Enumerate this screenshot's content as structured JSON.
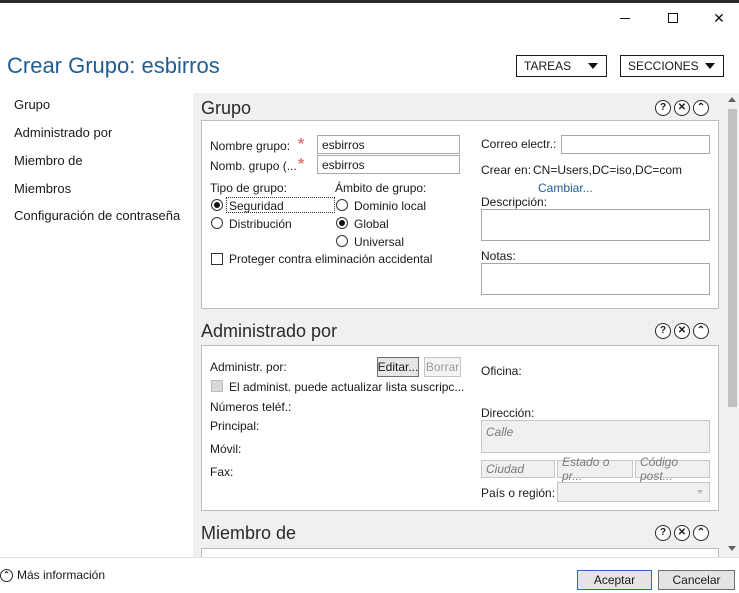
{
  "window": {
    "minimize_glyph": "—",
    "maximize_glyph": "☐",
    "close_glyph": "✕"
  },
  "header": {
    "title": "Crear Grupo: esbirros",
    "tasks_label": "TAREAS",
    "sections_label": "SECCIONES"
  },
  "nav": {
    "items": [
      {
        "label": "Grupo"
      },
      {
        "label": "Administrado por"
      },
      {
        "label": "Miembro de"
      },
      {
        "label": "Miembros"
      },
      {
        "label": "Configuración de contraseña"
      }
    ]
  },
  "section_controls": {
    "help": "?",
    "close": "✕",
    "collapse": "⌃"
  },
  "grupo": {
    "title": "Grupo",
    "group_name_label": "Nombre grupo:",
    "group_name_value": "esbirros",
    "group_name_pre2000_label": "Nomb. grupo (...",
    "group_name_pre2000_value": "esbirros",
    "group_type_label": "Tipo de grupo:",
    "type_security": "Seguridad",
    "type_distribution": "Distribución",
    "group_scope_label": "Ámbito de grupo:",
    "scope_domain_local": "Dominio local",
    "scope_global": "Global",
    "scope_universal": "Universal",
    "protect_label": "Proteger contra eliminación accidental",
    "email_label": "Correo electr.:",
    "email_value": "",
    "create_in_label": "Crear en:",
    "create_in_value": "CN=Users,DC=iso,DC=com",
    "change_link": "Cambiar...",
    "description_label": "Descripción:",
    "description_value": "",
    "notes_label": "Notas:",
    "notes_value": ""
  },
  "managed_by": {
    "title": "Administrado por",
    "managed_by_label": "Administr. por:",
    "edit_button": "Editar...",
    "clear_button": "Borrar",
    "manager_can_update_label": "El administ. puede actualizar lista suscripc...",
    "phone_numbers_label": "Números teléf.:",
    "main_label": "Principal:",
    "mobile_label": "Móvil:",
    "fax_label": "Fax:",
    "office_label": "Oficina:",
    "address_label": "Dirección:",
    "street_placeholder": "Calle",
    "city_placeholder": "Ciudad",
    "state_placeholder": "Estado o pr...",
    "postal_placeholder": "Código post...",
    "country_label": "País o región:"
  },
  "member_of": {
    "title": "Miembro de"
  },
  "footer": {
    "more_info": "Más información",
    "accept": "Aceptar",
    "cancel": "Cancelar"
  }
}
